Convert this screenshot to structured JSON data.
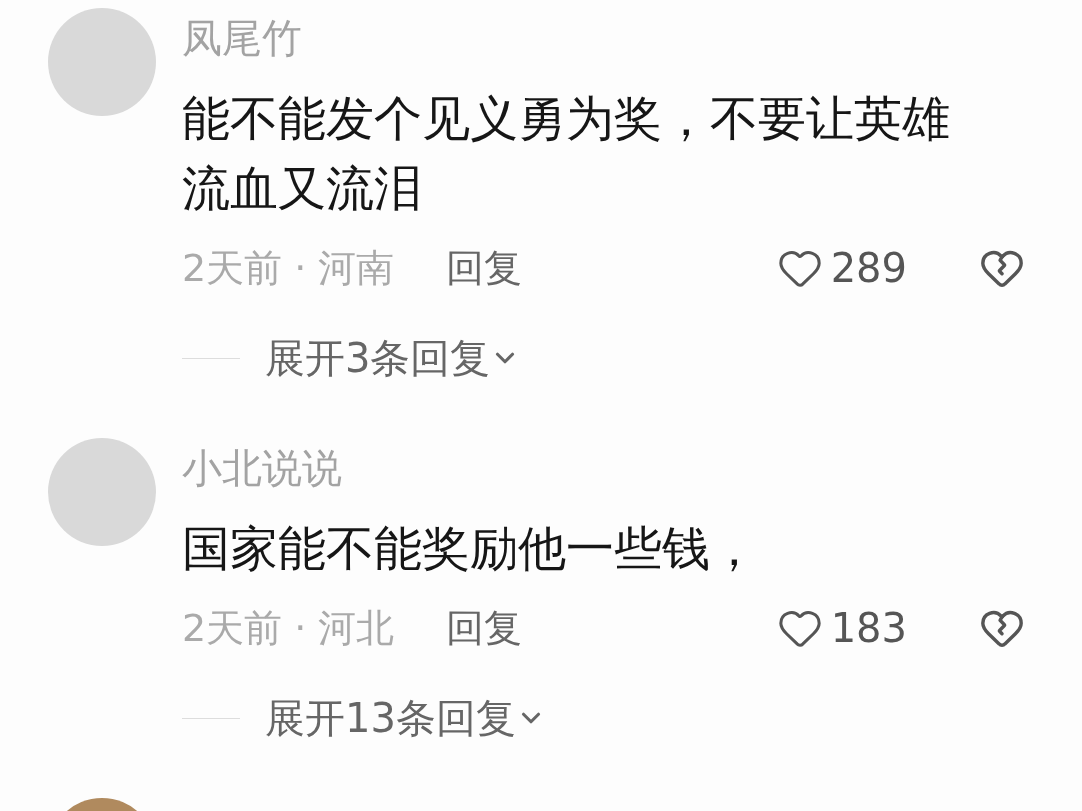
{
  "comments": [
    {
      "username": "凤尾竹",
      "text": "能不能发个见义勇为奖，不要让英雄流血又流泪",
      "meta": "2天前 · 河南",
      "reply_label": "回复",
      "likes": "289",
      "expand_label": "展开3条回复"
    },
    {
      "username": "小北说说",
      "text": "国家能不能奖励他一些钱，",
      "meta": "2天前 · 河北",
      "reply_label": "回复",
      "likes": "183",
      "expand_label": "展开13条回复"
    }
  ],
  "next_comment_partially_visible": true
}
